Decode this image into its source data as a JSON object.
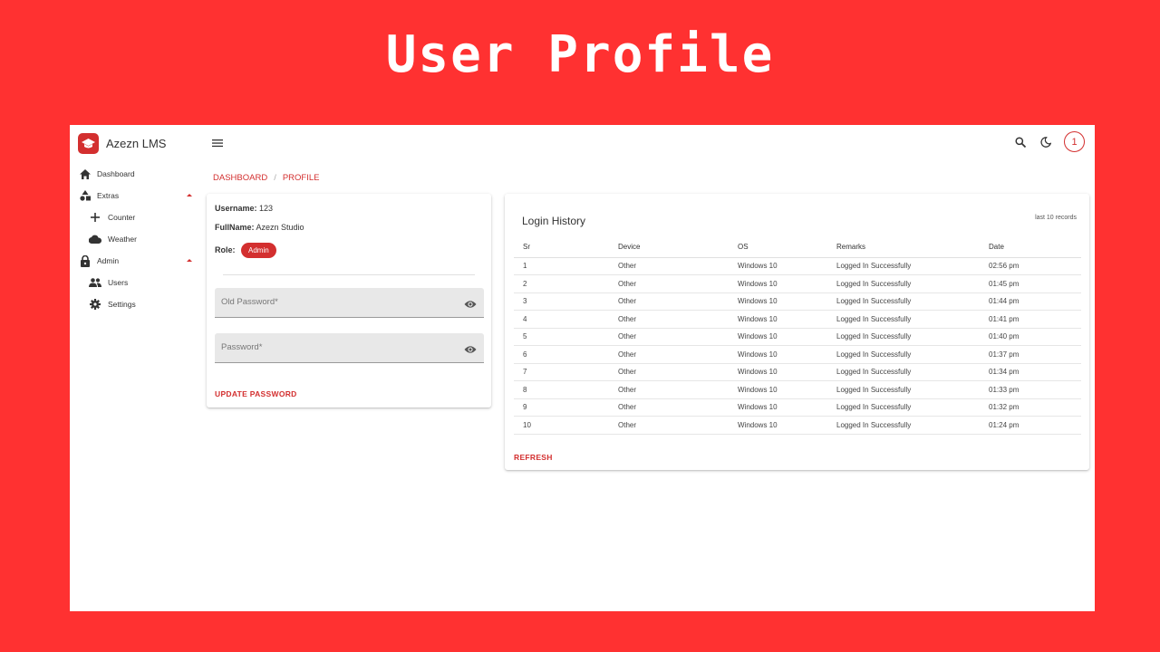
{
  "banner": {
    "title": "User Profile"
  },
  "brand": {
    "name": "Azezn LMS"
  },
  "sidebar": {
    "items": [
      {
        "label": "Dashboard",
        "icon": "home-icon"
      },
      {
        "label": "Extras",
        "icon": "shapes-icon"
      },
      {
        "label": "Counter",
        "icon": "plus-icon"
      },
      {
        "label": "Weather",
        "icon": "cloud-icon"
      },
      {
        "label": "Admin",
        "icon": "lock-icon"
      },
      {
        "label": "Users",
        "icon": "people-icon"
      },
      {
        "label": "Settings",
        "icon": "gear-icon"
      }
    ]
  },
  "topbar": {
    "avatar_text": "1"
  },
  "breadcrumb": {
    "items": [
      "DASHBOARD",
      "PROFILE"
    ],
    "separator": "/"
  },
  "profile": {
    "username_label": "Username:",
    "username": "123",
    "fullname_label": "FullName:",
    "fullname": "Azezn Studio",
    "role_label": "Role:",
    "role": "Admin",
    "old_password_placeholder": "Old Password*",
    "password_placeholder": "Password*",
    "update_button": "UPDATE PASSWORD"
  },
  "history": {
    "title": "Login History",
    "meta": "last 10 records",
    "columns": [
      "Sr",
      "Device",
      "OS",
      "Remarks",
      "Date"
    ],
    "rows": [
      [
        "1",
        "Other",
        "Windows 10",
        "Logged In Successfully",
        "02:56 pm"
      ],
      [
        "2",
        "Other",
        "Windows 10",
        "Logged In Successfully",
        "01:45 pm"
      ],
      [
        "3",
        "Other",
        "Windows 10",
        "Logged In Successfully",
        "01:44 pm"
      ],
      [
        "4",
        "Other",
        "Windows 10",
        "Logged In Successfully",
        "01:41 pm"
      ],
      [
        "5",
        "Other",
        "Windows 10",
        "Logged In Successfully",
        "01:40 pm"
      ],
      [
        "6",
        "Other",
        "Windows 10",
        "Logged In Successfully",
        "01:37 pm"
      ],
      [
        "7",
        "Other",
        "Windows 10",
        "Logged In Successfully",
        "01:34 pm"
      ],
      [
        "8",
        "Other",
        "Windows 10",
        "Logged In Successfully",
        "01:33 pm"
      ],
      [
        "9",
        "Other",
        "Windows 10",
        "Logged In Successfully",
        "01:32 pm"
      ],
      [
        "10",
        "Other",
        "Windows 10",
        "Logged In Successfully",
        "01:24 pm"
      ]
    ],
    "refresh_button": "REFRESH"
  },
  "colors": {
    "background": "#ff3131",
    "accent": "#d32f2f"
  }
}
